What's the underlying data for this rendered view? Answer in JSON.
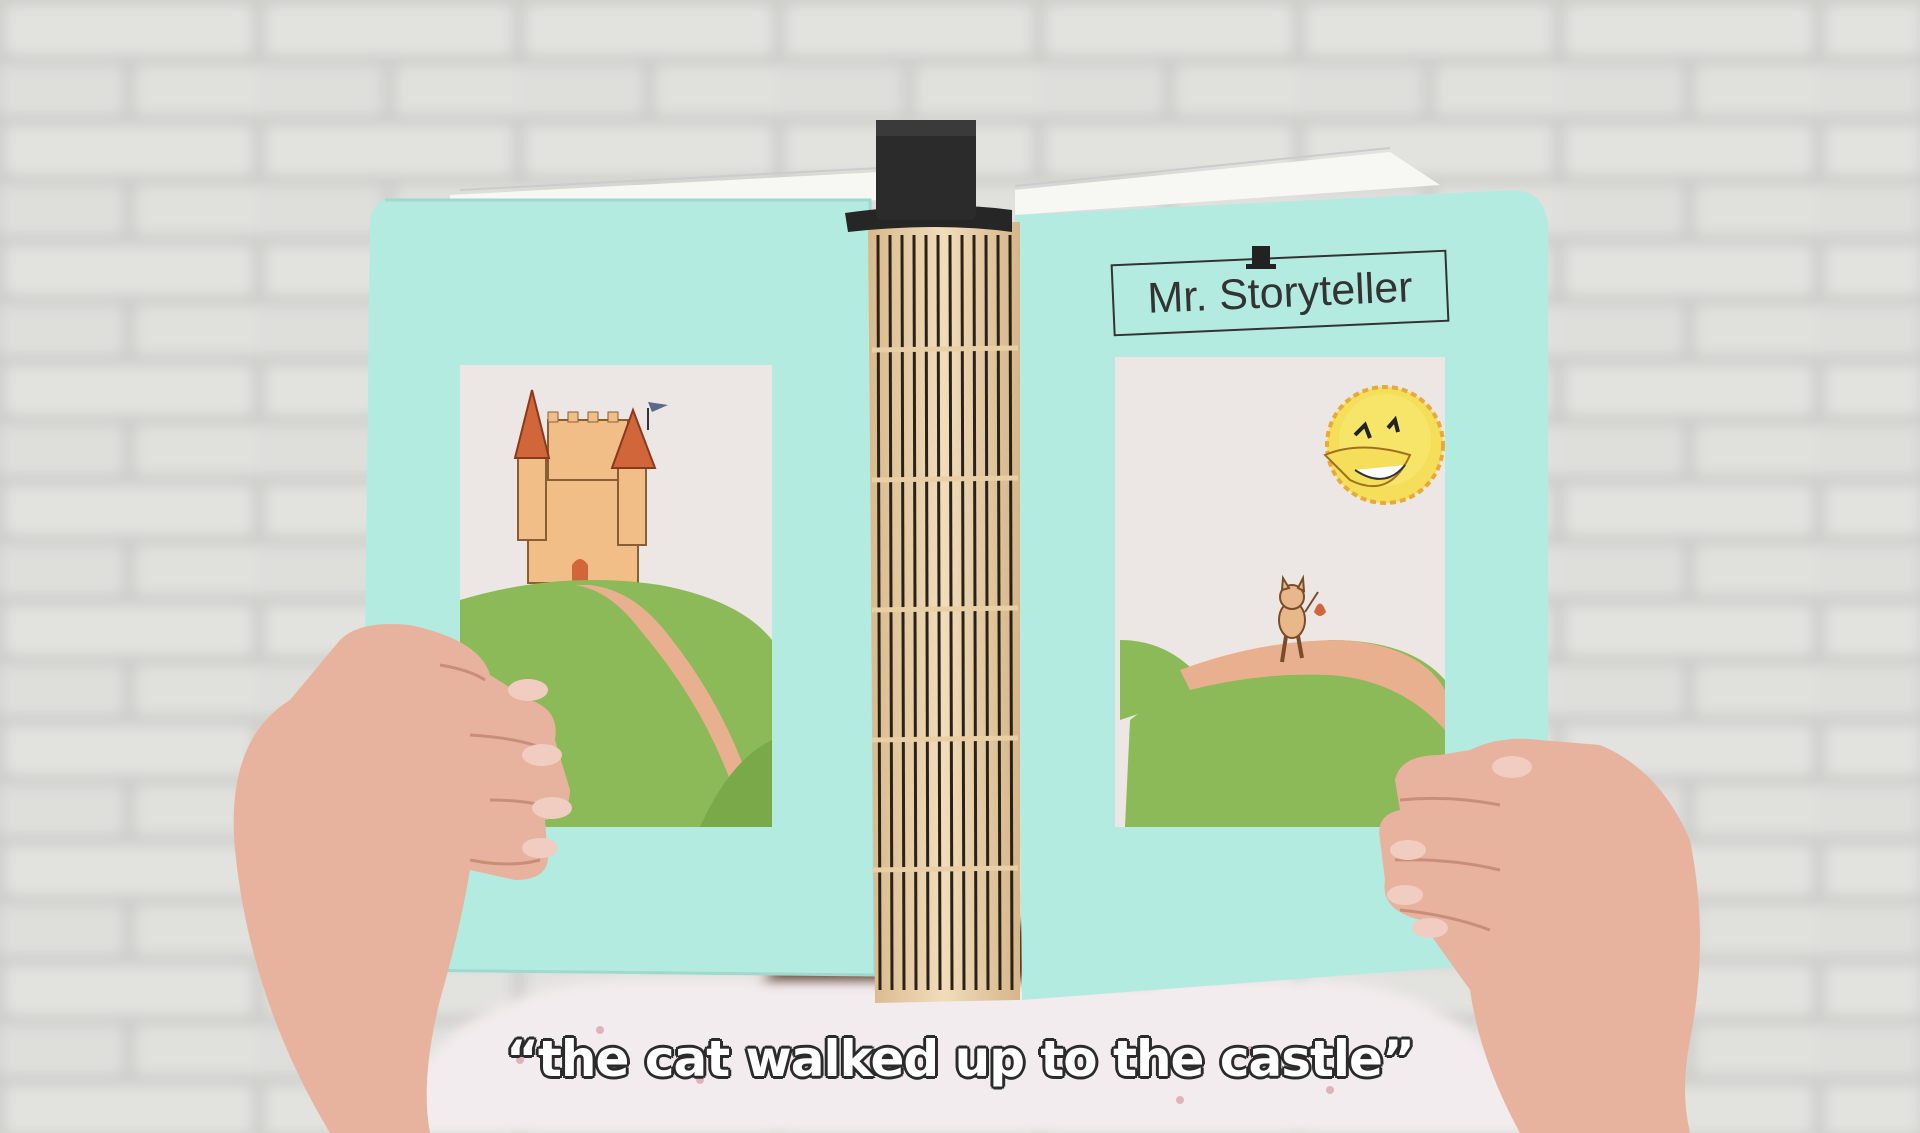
{
  "brand": {
    "title": "Mr. Storyteller"
  },
  "caption": {
    "text": "“the cat walked up to the castle”"
  },
  "colors": {
    "page": "#b4ebe0",
    "wall": "#cfcfcc",
    "spine": "#e9cfa6",
    "bookmark": "#2a2a2a",
    "hill": "#8cba58",
    "path": "#e8b08f",
    "castle": "#f0be86",
    "roof": "#d0663a",
    "sun": "#f4de5a"
  },
  "scene": {
    "left_page": "castle-on-hill-illustration",
    "right_page": "cat-walking-hill-illustration",
    "icons": [
      "top-hat-icon",
      "sun-icon",
      "cat-icon",
      "castle-icon",
      "bookmark-icon"
    ]
  }
}
